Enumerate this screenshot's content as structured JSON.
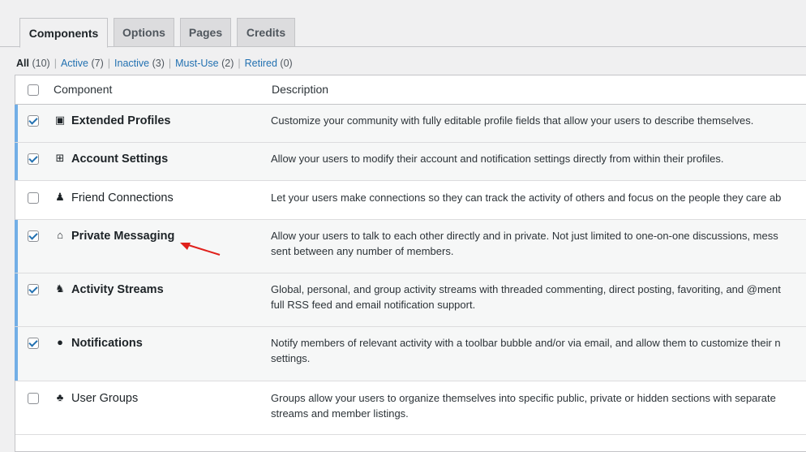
{
  "tabs": [
    {
      "label": "Components",
      "active": true
    },
    {
      "label": "Options"
    },
    {
      "label": "Pages"
    },
    {
      "label": "Credits"
    }
  ],
  "filters": {
    "all": {
      "label": "All",
      "count": "(10)"
    },
    "active": {
      "label": "Active",
      "count": "(7)"
    },
    "inactive": {
      "label": "Inactive",
      "count": "(3)"
    },
    "must_use": {
      "label": "Must-Use",
      "count": "(2)"
    },
    "retired": {
      "label": "Retired",
      "count": "(0)"
    }
  },
  "table": {
    "col_component": "Component",
    "col_description": "Description",
    "rows": [
      {
        "name": "Extended Profiles",
        "icon": "profile-card-icon",
        "glyph": "▣",
        "checked": true,
        "desc1": "Customize your community with fully editable profile fields that allow your users to describe themselves.",
        "desc2": ""
      },
      {
        "name": "Account Settings",
        "icon": "settings-icon",
        "glyph": "⊞",
        "checked": true,
        "desc1": "Allow your users to modify their account and notification settings directly from within their profiles.",
        "desc2": ""
      },
      {
        "name": "Friend Connections",
        "icon": "friends-icon",
        "glyph": "♟",
        "checked": false,
        "desc1": "Let your users make connections so they can track the activity of others and focus on the people they care ab",
        "desc2": ""
      },
      {
        "name": "Private Messaging",
        "icon": "inbox-icon",
        "glyph": "⌂",
        "checked": true,
        "desc1": "Allow your users to talk to each other directly and in private. Not just limited to one-on-one discussions, mess",
        "desc2": "sent between any number of members."
      },
      {
        "name": "Activity Streams",
        "icon": "activity-icon",
        "glyph": "♞",
        "checked": true,
        "desc1": "Global, personal, and group activity streams with threaded commenting, direct posting, favoriting, and @ment",
        "desc2": "full RSS feed and email notification support."
      },
      {
        "name": "Notifications",
        "icon": "lightbulb-icon",
        "glyph": "●",
        "checked": true,
        "desc1": "Notify members of relevant activity with a toolbar bubble and/or via email, and allow them to customize their n",
        "desc2": "settings."
      },
      {
        "name": "User Groups",
        "icon": "groups-icon",
        "glyph": "♣",
        "checked": false,
        "desc1": "Groups allow your users to organize themselves into specific public, private or hidden sections with separate",
        "desc2": "streams and member listings."
      }
    ]
  },
  "colors": {
    "accent": "#2271b1",
    "active_bar": "#72aee6",
    "annotation_arrow": "#e0201b"
  }
}
